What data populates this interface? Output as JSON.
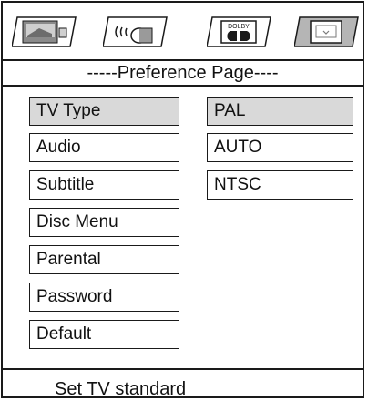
{
  "icon_tabs": [
    {
      "name": "general-setup-icon"
    },
    {
      "name": "audio-setup-icon"
    },
    {
      "name": "dolby-setup-icon",
      "label": "DOLBY"
    },
    {
      "name": "preference-icon",
      "active": true
    }
  ],
  "page_title": "-----Preference Page----",
  "menu_items": [
    {
      "label": "TV Type",
      "selected": true
    },
    {
      "label": "Audio"
    },
    {
      "label": "Subtitle"
    },
    {
      "label": "Disc Menu"
    },
    {
      "label": "Parental"
    },
    {
      "label": "Password"
    },
    {
      "label": "Default"
    }
  ],
  "options": [
    {
      "label": "PAL",
      "selected": true
    },
    {
      "label": "AUTO"
    },
    {
      "label": "NTSC"
    }
  ],
  "status_text": "Set TV standard",
  "colors": {
    "border": "#1a1a1a",
    "highlight": "#d9d9d9",
    "icon_gray": "#7a7a7a"
  }
}
